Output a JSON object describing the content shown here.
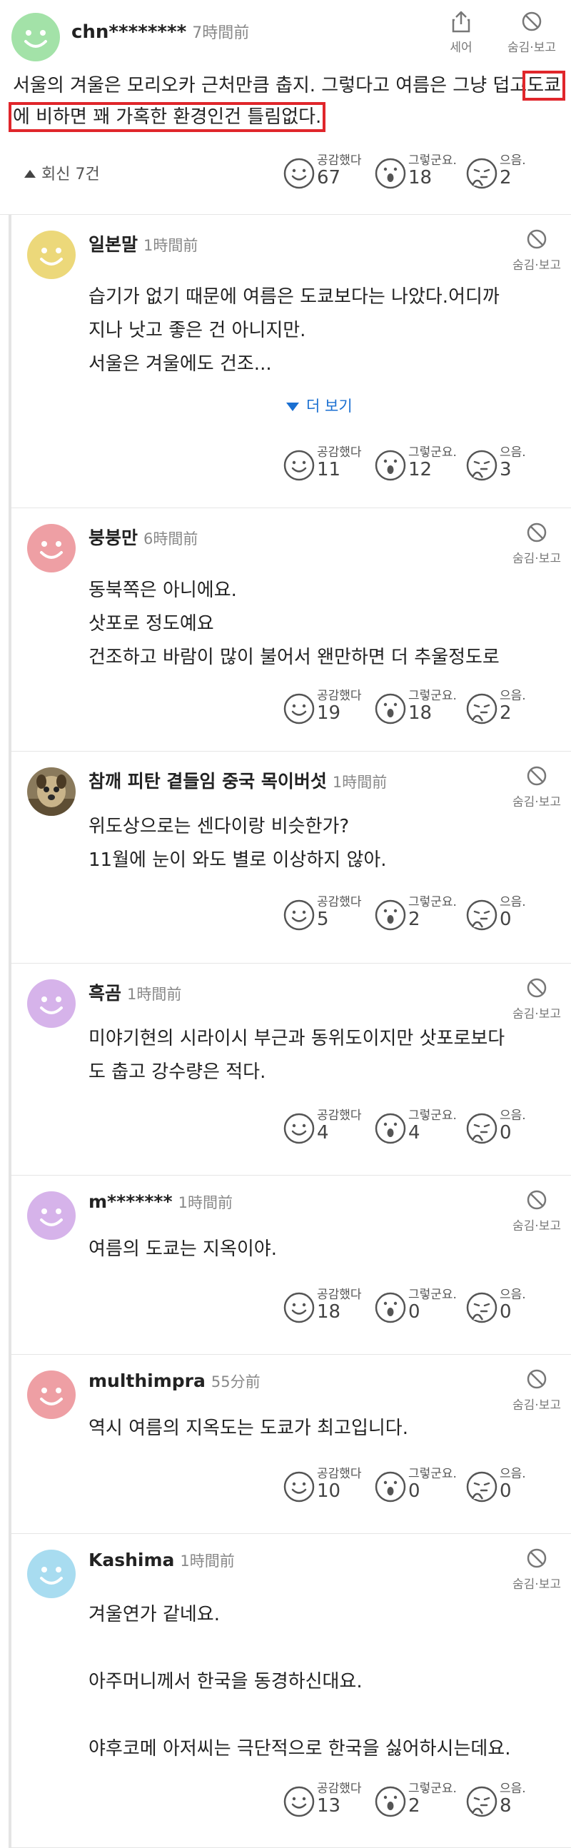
{
  "main_comment": {
    "username": "chn********",
    "time": "7時間前",
    "share_label": "세어",
    "hide_label": "숨김·보고",
    "text_before": "서울의 겨울은 모리오카 근처만큼 춥지. 그렇다고 여름은 그냥 덥고",
    "text_highlight": "도쿄에 비하면 꽤 가혹한 환경인건 틀림없다.",
    "replies_label": "회신 7건",
    "reactions": [
      {
        "label": "공감했다",
        "count": "67"
      },
      {
        "label": "그렇군요.",
        "count": "18"
      },
      {
        "label": "으음.",
        "count": "2"
      }
    ]
  },
  "replies": [
    {
      "username": "일본말",
      "time": "1時間前",
      "avatar_color": "#ecd87a",
      "text": "습기가 없기 때문에 여름은 도쿄보다는 나았다.어디까\n지나 낫고 좋은 건 아니지만.\n서울은 겨울에도 건조...",
      "more": "더 보기",
      "reactions": [
        {
          "label": "공감했다",
          "count": "11"
        },
        {
          "label": "그렇군요.",
          "count": "12"
        },
        {
          "label": "으음.",
          "count": "3"
        }
      ]
    },
    {
      "username": "붕붕만",
      "time": "6時間前",
      "avatar_color": "#ee9fa4",
      "text": "동북쪽은 아니에요.\n삿포로 정도예요\n건조하고 바람이 많이 불어서 왠만하면 더 추울정도로",
      "reactions": [
        {
          "label": "공감했다",
          "count": "19"
        },
        {
          "label": "그렇군요.",
          "count": "18"
        },
        {
          "label": "으음.",
          "count": "2"
        }
      ]
    },
    {
      "username": "참깨 피탄 곁들임 중국 목이버섯",
      "time": "1時間前",
      "avatar_color": "#6e5a3a",
      "avatar_type": "photo",
      "text": "위도상으로는 센다이랑 비슷한가?\n11월에 눈이 와도 별로 이상하지 않아.",
      "reactions": [
        {
          "label": "공감했다",
          "count": "5"
        },
        {
          "label": "그렇군요.",
          "count": "2"
        },
        {
          "label": "으음.",
          "count": "0"
        }
      ]
    },
    {
      "username": "흑곰",
      "time": "1時間前",
      "avatar_color": "#d6b3ea",
      "text": "미야기현의 시라이시 부근과 동위도이지만 삿포로보다\n도 춥고 강수량은 적다.",
      "reactions": [
        {
          "label": "공감했다",
          "count": "4"
        },
        {
          "label": "그렇군요.",
          "count": "4"
        },
        {
          "label": "으음.",
          "count": "0"
        }
      ]
    },
    {
      "username": "m*******",
      "time": "1時間前",
      "avatar_color": "#d6b3ea",
      "text": "여름의 도쿄는 지옥이야.",
      "reactions": [
        {
          "label": "공감했다",
          "count": "18"
        },
        {
          "label": "그렇군요.",
          "count": "0"
        },
        {
          "label": "으음.",
          "count": "0"
        }
      ]
    },
    {
      "username": "multhimpra",
      "time": "55分前",
      "avatar_color": "#ee9fa4",
      "text": "역시 여름의 지옥도는 도쿄가 최고입니다.",
      "reactions": [
        {
          "label": "공감했다",
          "count": "10"
        },
        {
          "label": "그렇군요.",
          "count": "0"
        },
        {
          "label": "으음.",
          "count": "0"
        }
      ]
    },
    {
      "username": "Kashima",
      "time": "1時間前",
      "avatar_color": "#a8dcf0",
      "text": "겨울연가 같네요.\n\n아주머니께서 한국을 동경하신대요.\n\n야후코메 아저씨는 극단적으로 한국을 싫어하시는데요.",
      "reactions": [
        {
          "label": "공감했다",
          "count": "13"
        },
        {
          "label": "그렇군요.",
          "count": "2"
        },
        {
          "label": "으음.",
          "count": "8"
        }
      ]
    }
  ],
  "colors": {
    "highlight_box": "#e0262b",
    "more_link": "#1a6fd1",
    "top_avatar": "#a3e2a8"
  },
  "icons": [
    "share-icon",
    "hide-report-icon",
    "smile-face-icon",
    "surprised-face-icon",
    "thinking-face-icon",
    "triangle-up-icon",
    "triangle-down-icon"
  ]
}
